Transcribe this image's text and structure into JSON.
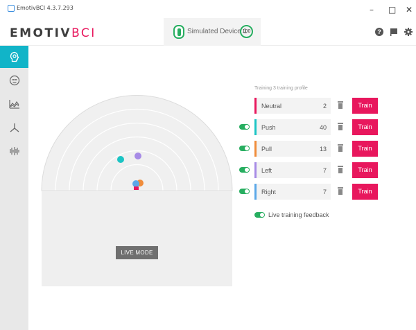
{
  "window": {
    "title": "EmotivBCI 4.3.7.293",
    "minimize": "–",
    "maximize": "□",
    "close": "✕"
  },
  "brand": {
    "part1": "EMOTIV",
    "part2": "BCI"
  },
  "device": {
    "label": "Simulated Device 1",
    "battery": "100"
  },
  "header_icons": [
    "help-icon",
    "flag-icon",
    "settings-icon"
  ],
  "sidebar": {
    "items": [
      {
        "icon": "head-training-icon",
        "active": true
      },
      {
        "icon": "face-icon",
        "active": false
      },
      {
        "icon": "chart-icon",
        "active": false
      },
      {
        "icon": "tri-axis-icon",
        "active": false
      },
      {
        "icon": "waveform-icon",
        "active": false
      }
    ]
  },
  "main": {
    "live_mode_label": "LIVE MODE",
    "profile_label": "Training 3 training profile",
    "rows": [
      {
        "name": "Neutral",
        "count": "2",
        "color": "#e8175d",
        "toggle": false,
        "train_label": "Train"
      },
      {
        "name": "Push",
        "count": "40",
        "color": "#1bc4c4",
        "toggle": true,
        "train_label": "Train"
      },
      {
        "name": "Pull",
        "count": "13",
        "color": "#f08c3a",
        "toggle": true,
        "train_label": "Train"
      },
      {
        "name": "Left",
        "count": "7",
        "color": "#a78be6",
        "toggle": true,
        "train_label": "Train"
      },
      {
        "name": "Right",
        "count": "7",
        "color": "#5ba8e8",
        "toggle": true,
        "train_label": "Train"
      }
    ],
    "live_feedback_label": "Live training feedback"
  },
  "colors": {
    "accent": "#e8175d",
    "teal": "#11b4c8",
    "toggle_on": "#27ae60"
  }
}
